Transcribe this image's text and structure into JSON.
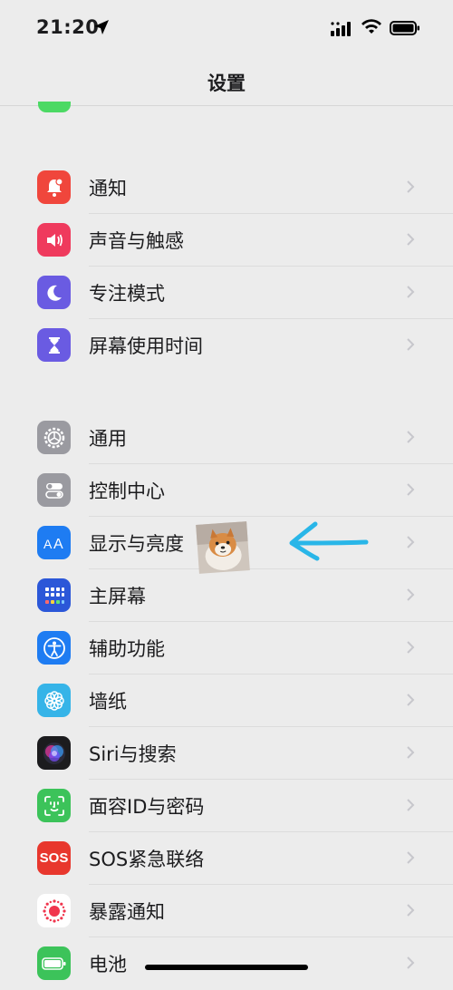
{
  "status_bar": {
    "time": "21:20"
  },
  "nav": {
    "title": "设置"
  },
  "groups": [
    {
      "items": [
        {
          "label": "通知",
          "icon": "bell-icon",
          "color": "#f0463c"
        },
        {
          "label": "声音与触感",
          "icon": "speaker-icon",
          "color": "#ef3a5d"
        },
        {
          "label": "专注模式",
          "icon": "moon-icon",
          "color": "#6a5be2"
        },
        {
          "label": "屏幕使用时间",
          "icon": "hourglass-icon",
          "color": "#6a5be2"
        }
      ]
    },
    {
      "items": [
        {
          "label": "通用",
          "icon": "gear-icon",
          "color": "#9a9aa0"
        },
        {
          "label": "控制中心",
          "icon": "toggles-icon",
          "color": "#9a9aa0"
        },
        {
          "label": "显示与亮度",
          "icon": "text-size-icon",
          "color": "#1e7cf2"
        },
        {
          "label": "主屏幕",
          "icon": "home-grid-icon",
          "color": "#2b57d8"
        },
        {
          "label": "辅助功能",
          "icon": "accessibility-icon",
          "color": "#1e7cf2"
        },
        {
          "label": "墙纸",
          "icon": "flower-icon",
          "color": "#36b4e8"
        },
        {
          "label": "Siri与搜索",
          "icon": "siri-icon",
          "color": "#1c1c1e"
        },
        {
          "label": "面容ID与密码",
          "icon": "face-id-icon",
          "color": "#3cc35a"
        },
        {
          "label": "SOS紧急联络",
          "icon_text": "SOS",
          "icon": "sos-icon",
          "color": "#e8372d"
        },
        {
          "label": "暴露通知",
          "icon": "exposure-icon",
          "color": "#ffffff"
        },
        {
          "label": "电池",
          "icon": "battery-icon",
          "color": "#3cc35a"
        }
      ]
    }
  ],
  "annotation": {
    "arrow_color": "#29b6e8"
  }
}
